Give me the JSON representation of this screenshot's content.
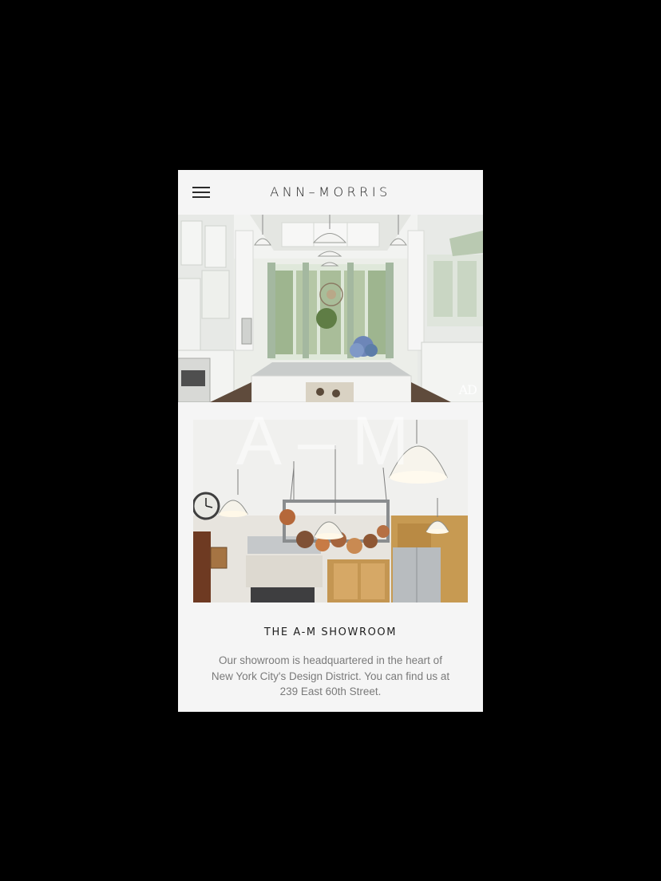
{
  "header": {
    "logo": "ANN–MORRIS",
    "menu_icon": "hamburger-menu-icon"
  },
  "hero": {
    "badge": "AD"
  },
  "watermark": "A–M",
  "showroom": {
    "title": "THE A-M SHOWROOM",
    "body": "Our showroom is headquartered in the heart of New York City's Design District. You can find us at 239 East 60th Street."
  },
  "colors": {
    "page_background": "#000000",
    "screen_background": "#f5f5f5",
    "text_dark": "#1f1f1f",
    "text_muted": "#7a7a7a"
  }
}
